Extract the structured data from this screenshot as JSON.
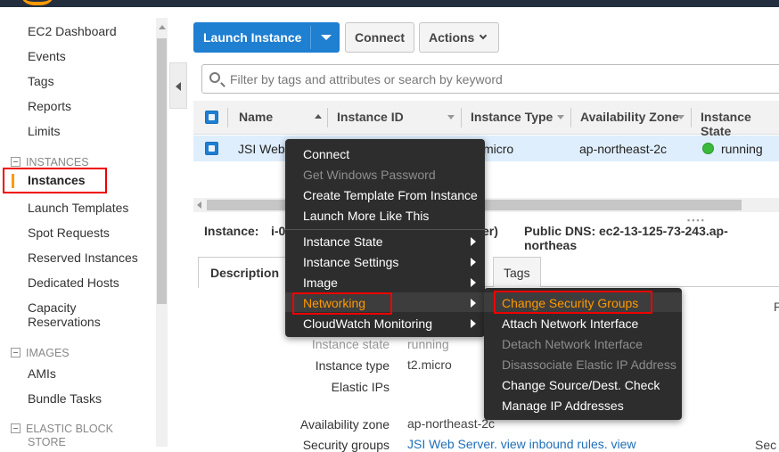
{
  "sidebar": {
    "items": [
      "EC2 Dashboard",
      "Events",
      "Tags",
      "Reports",
      "Limits"
    ],
    "instances_header": "INSTANCES",
    "instances_items": [
      "Instances",
      "Launch Templates",
      "Spot Requests",
      "Reserved Instances",
      "Dedicated Hosts",
      "Capacity",
      "Reservations"
    ],
    "images_header": "IMAGES",
    "images_items": [
      "AMIs",
      "Bundle Tasks"
    ],
    "ebs_header_1": "ELASTIC BLOCK",
    "ebs_header_2": "STORE"
  },
  "toolbar": {
    "launch": "Launch Instance",
    "connect": "Connect",
    "actions": "Actions"
  },
  "search": {
    "placeholder": "Filter by tags and attributes or search by keyword"
  },
  "table": {
    "headers": [
      "Name",
      "Instance ID",
      "Instance Type",
      "Availability Zone",
      "Instance State"
    ],
    "row": {
      "name": "JSI Web",
      "type": "micro",
      "az": "ap-northeast-2c",
      "state": "running"
    }
  },
  "detail": {
    "instance_label": "Instance:",
    "instance_id": "i-0",
    "server_tail": "er)",
    "public_dns": "Public DNS: ec2-13-125-73-243.ap-northeas",
    "tabs": [
      "Description",
      "Tags"
    ],
    "fields": [
      {
        "k": "Instance state",
        "v": "running"
      },
      {
        "k": "Instance type",
        "v": "t2.micro"
      },
      {
        "k": "Elastic IPs",
        "v": ""
      },
      {
        "k": "Availability zone",
        "v": "ap-northeast-2c"
      },
      {
        "k": "Security groups",
        "v": "JSI Web Server. view inbound rules. view"
      }
    ],
    "right_p": "P",
    "right_sec": "Sec"
  },
  "context_menu": {
    "items": [
      "Connect",
      "Get Windows Password",
      "Create Template From Instance",
      "Launch More Like This",
      "Instance State",
      "Instance Settings",
      "Image",
      "Networking",
      "CloudWatch Monitoring"
    ]
  },
  "networking_menu": {
    "items": [
      "Change Security Groups",
      "Attach Network Interface",
      "Detach Network Interface",
      "Disassociate Elastic IP Address",
      "Change Source/Dest. Check",
      "Manage IP Addresses"
    ]
  },
  "colors": {
    "accent": "#1f7fd1",
    "highlight": "#ff9900",
    "annotation": "#ee0000"
  }
}
